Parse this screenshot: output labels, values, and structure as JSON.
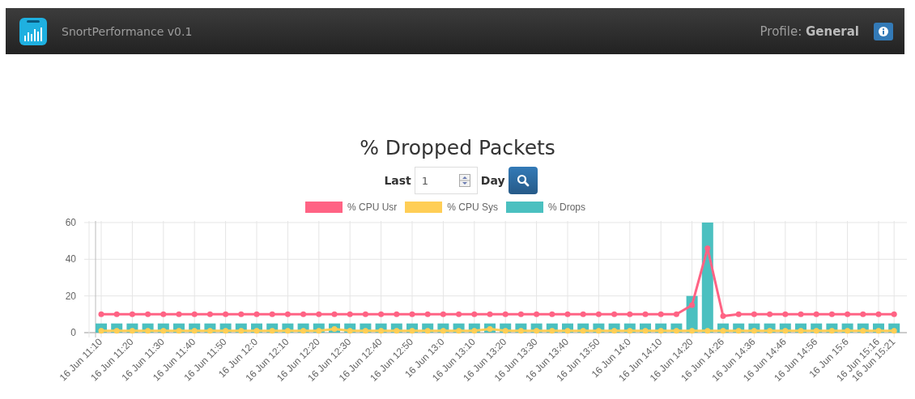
{
  "navbar": {
    "brand": "SnortPerformance v0.1",
    "profile_label": "Profile:",
    "profile_name": "General"
  },
  "heading": "% Dropped Packets",
  "range": {
    "prefix": "Last",
    "value": "1",
    "unit": "Day"
  },
  "chart": {
    "chart_data": {
      "type": "bar",
      "grid": true,
      "legend": "top",
      "ylim": [
        0,
        60
      ],
      "yticks": [
        0,
        20,
        40,
        60
      ],
      "categories": [
        "16 Jun 11:10",
        null,
        "16 Jun 11:20",
        null,
        "16 Jun 11:30",
        null,
        "16 Jun 11:40",
        null,
        "16 Jun 11:50",
        null,
        "16 Jun 12:0",
        null,
        "16 Jun 12:10",
        null,
        "16 Jun 12:20",
        null,
        "16 Jun 12:30",
        null,
        "16 Jun 12:40",
        null,
        "16 Jun 12:50",
        null,
        "16 Jun 13:0",
        null,
        "16 Jun 13:10",
        null,
        "16 Jun 13:20",
        null,
        "16 Jun 13:30",
        null,
        "16 Jun 13:40",
        null,
        "16 Jun 13:50",
        null,
        "16 Jun 14:0",
        null,
        "16 Jun 14:10",
        null,
        "16 Jun 14:20",
        null,
        "16 Jun 14:26",
        null,
        "16 Jun 14:36",
        null,
        "16 Jun 14:46",
        null,
        "16 Jun 14:56",
        null,
        "16 Jun 15:6",
        null,
        "16 Jun 15:16",
        "16 Jun 15:21"
      ],
      "series": [
        {
          "name": "% CPU Usr",
          "color": "#ff6384",
          "type": "line",
          "marker": "circle",
          "values": [
            10,
            10,
            10,
            10,
            10,
            10,
            10,
            10,
            10,
            10,
            10,
            10,
            10,
            10,
            10,
            10,
            10,
            10,
            10,
            10,
            10,
            10,
            10,
            10,
            10,
            10,
            10,
            10,
            10,
            10,
            10,
            10,
            10,
            10,
            10,
            10,
            10,
            10,
            15,
            46,
            9,
            10,
            10,
            10,
            10,
            10,
            10,
            10,
            10,
            10,
            10,
            10
          ]
        },
        {
          "name": "% CPU Sys",
          "color": "#ffce56",
          "type": "line",
          "marker": "circle",
          "values": [
            1,
            1,
            1,
            1,
            1,
            1,
            1,
            1,
            1,
            1,
            1,
            1,
            1,
            1,
            1,
            2,
            1,
            1,
            1,
            1,
            1,
            1,
            1,
            1,
            1,
            2,
            1,
            1,
            1,
            1,
            1,
            1,
            1,
            1,
            1,
            1,
            1,
            1,
            1,
            1,
            1,
            1,
            1,
            1,
            1,
            1,
            1,
            1,
            1,
            1,
            1,
            1
          ]
        },
        {
          "name": "% Drops",
          "color": "#4bc0c0",
          "values": [
            5,
            5,
            5,
            5,
            5,
            5,
            5,
            5,
            5,
            5,
            5,
            5,
            5,
            5,
            5,
            5,
            5,
            5,
            5,
            5,
            5,
            5,
            5,
            5,
            5,
            5,
            5,
            5,
            5,
            5,
            5,
            5,
            5,
            5,
            5,
            5,
            5,
            5,
            20,
            60,
            5,
            5,
            5,
            5,
            5,
            5,
            5,
            5,
            5,
            5,
            5,
            5
          ]
        }
      ]
    }
  }
}
